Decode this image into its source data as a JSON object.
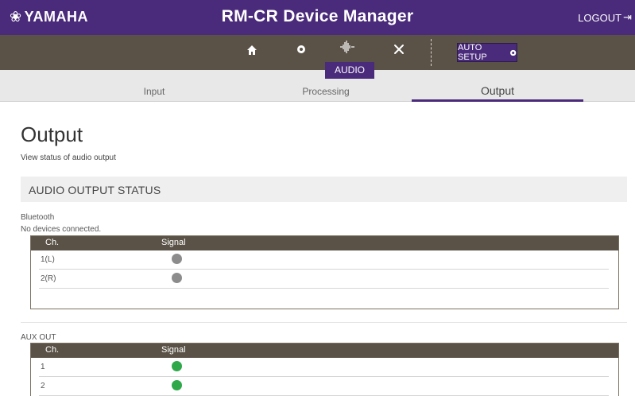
{
  "header": {
    "brand": "YAMAHA",
    "brand_icon": "tuning-fork-emblem-icon",
    "title": "RM-CR Device Manager",
    "logout_label": "LOGOUT",
    "logout_icon": "logout-arrow-icon",
    "accent_color": "#4a2a7a"
  },
  "nav": {
    "items": [
      {
        "icon": "home-icon"
      },
      {
        "icon": "gear-icon"
      },
      {
        "icon": "audio-waveform-icon",
        "label": "AUDIO"
      },
      {
        "icon": "tools-icon"
      }
    ],
    "active_label": "AUDIO",
    "auto_setup_label": "AUTO SETUP",
    "auto_setup_icon": "gear-icon",
    "bar_color": "#5a5247"
  },
  "subtabs": {
    "input": "Input",
    "processing": "Processing",
    "output": "Output",
    "active": "Output"
  },
  "page": {
    "title": "Output",
    "description": "View status of audio output",
    "section_title": "AUDIO OUTPUT STATUS"
  },
  "bluetooth": {
    "label": "Bluetooth",
    "status": "No devices connected.",
    "columns": {
      "ch": "Ch.",
      "signal": "Signal"
    },
    "rows": [
      {
        "ch": "1(L)",
        "signal": "off"
      },
      {
        "ch": "2(R)",
        "signal": "off"
      }
    ]
  },
  "aux_out": {
    "label": "AUX OUT",
    "columns": {
      "ch": "Ch.",
      "signal": "Signal"
    },
    "rows": [
      {
        "ch": "1",
        "signal": "on"
      },
      {
        "ch": "2",
        "signal": "on"
      }
    ]
  },
  "signal_colors": {
    "on": "#2fa84a",
    "off": "#8c8c8c"
  }
}
